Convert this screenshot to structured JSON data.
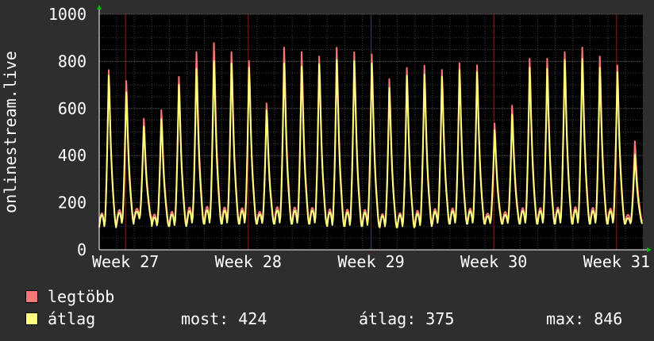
{
  "chart_data": {
    "type": "line",
    "ylabel": "onlinestream.live",
    "ylim": [
      0,
      1000
    ],
    "yticks": [
      0,
      200,
      400,
      600,
      800,
      1000
    ],
    "xticks": [
      "Week 27",
      "Week 28",
      "Week 29",
      "Week 30",
      "Week 31"
    ],
    "grid": true,
    "background": "#000000",
    "grid_color": "#404040",
    "week_line_color": "#8a1f1f",
    "series": [
      {
        "name": "legtöbb",
        "color": "#f87878",
        "peaks": [
          800,
          750,
          580,
          620,
          770,
          880,
          920,
          880,
          840,
          650,
          900,
          880,
          860,
          900,
          880,
          870,
          760,
          810,
          820,
          800,
          830,
          820,
          560,
          640,
          850,
          850,
          880,
          900,
          860,
          820,
          480
        ],
        "troughs": [
          100,
          120,
          140,
          110,
          110,
          120,
          120,
          120,
          120,
          120,
          120,
          120,
          120,
          110,
          110,
          110,
          100,
          100,
          110,
          120,
          120,
          120,
          120,
          120,
          120,
          120,
          120,
          120,
          120,
          120,
          120
        ]
      },
      {
        "name": "átlag",
        "color": "#ffff80",
        "peaks": [
          775,
          700,
          545,
          580,
          735,
          805,
          840,
          830,
          810,
          620,
          830,
          815,
          825,
          845,
          840,
          830,
          720,
          775,
          780,
          770,
          800,
          790,
          530,
          600,
          810,
          805,
          845,
          850,
          810,
          790,
          420
        ],
        "troughs": [
          95,
          110,
          130,
          100,
          100,
          110,
          110,
          110,
          110,
          110,
          110,
          110,
          110,
          100,
          100,
          100,
          95,
          95,
          100,
          110,
          110,
          110,
          110,
          110,
          110,
          110,
          110,
          110,
          110,
          110,
          110
        ]
      }
    ]
  },
  "legend": {
    "max_label": "legtöbb",
    "avg_label": "átlag",
    "now_text": "most: 424",
    "avg_text": "átlag: 375",
    "peak_text": "max: 846",
    "max_color": "#f87878",
    "avg_color": "#ffff80"
  }
}
